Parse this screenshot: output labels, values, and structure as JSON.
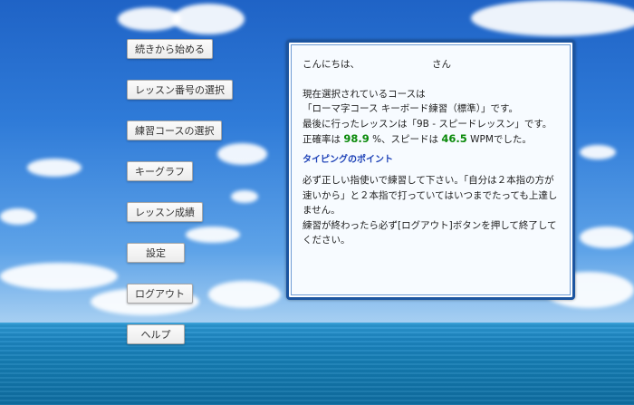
{
  "sidebar": {
    "buttons": [
      {
        "label": "続きから始める"
      },
      {
        "label": "レッスン番号の選択"
      },
      {
        "label": "練習コースの選択"
      },
      {
        "label": "キーグラフ"
      },
      {
        "label": "レッスン成績"
      },
      {
        "label": "設定"
      },
      {
        "label": "ログアウト"
      },
      {
        "label": "ヘルプ"
      }
    ]
  },
  "panel": {
    "greeting_prefix": "こんにちは、",
    "greeting_name": "",
    "greeting_suffix": "さん",
    "course_line1": "現在選択されているコースは",
    "course_line2": "「ローマ字コース キーボード練習（標準）」です。",
    "last_lesson": "最後に行ったレッスンは「9B - スピードレッスン」です。",
    "accuracy_prefix": "正確率は",
    "accuracy_value": "98.9",
    "accuracy_unit": "%、スピードは",
    "speed_value": "46.5",
    "speed_suffix": "WPMでした。",
    "tips_title": "タイピングのポイント",
    "tips_line1": "必ず正しい指使いで練習して下さい。「自分は２本指の方が速いから」と２本指で打っていてはいつまでたっても上達しません。",
    "tips_line2": "練習が終わったら必ず[ログアウト]ボタンを押して終了してください。"
  },
  "colors": {
    "accent_green": "#0b8a0b",
    "tips_blue": "#2044b8",
    "panel_border": "#1c55a0"
  }
}
